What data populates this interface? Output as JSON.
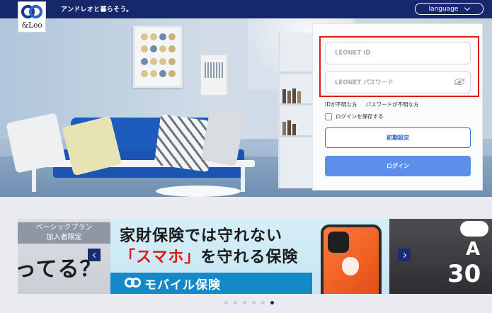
{
  "header": {
    "logo_text": "&Leo",
    "tagline": "アンドレオと暮らそう。",
    "language_label": "language"
  },
  "login": {
    "id_placeholder": "LEONET ID",
    "password_placeholder": "LEONET パスワード",
    "forgot_id": "IDが不明な方",
    "forgot_password": "パスワードが不明な方",
    "remember_label": "ログインを保存する",
    "initial_setup_button": "初期設定",
    "login_button": "ログイン"
  },
  "carousel": {
    "left_slide": {
      "plan_line1": "ベーシックプラン",
      "plan_line2": "加入者限定",
      "big_text": "ってる？"
    },
    "main_slide": {
      "line1": "家財保険では守れない",
      "line2_red": "「スマホ」",
      "line2_rest": "を守れる保険",
      "banner": "モバイル保険"
    },
    "right_slide": {
      "letter": "A",
      "number": "30"
    },
    "dot_count": 6,
    "active_dot": 5
  },
  "colors": {
    "header_bg": "#16286b",
    "login_button": "#5b8fea",
    "highlight": "#e0191a",
    "banner_blue": "#1588c8"
  }
}
